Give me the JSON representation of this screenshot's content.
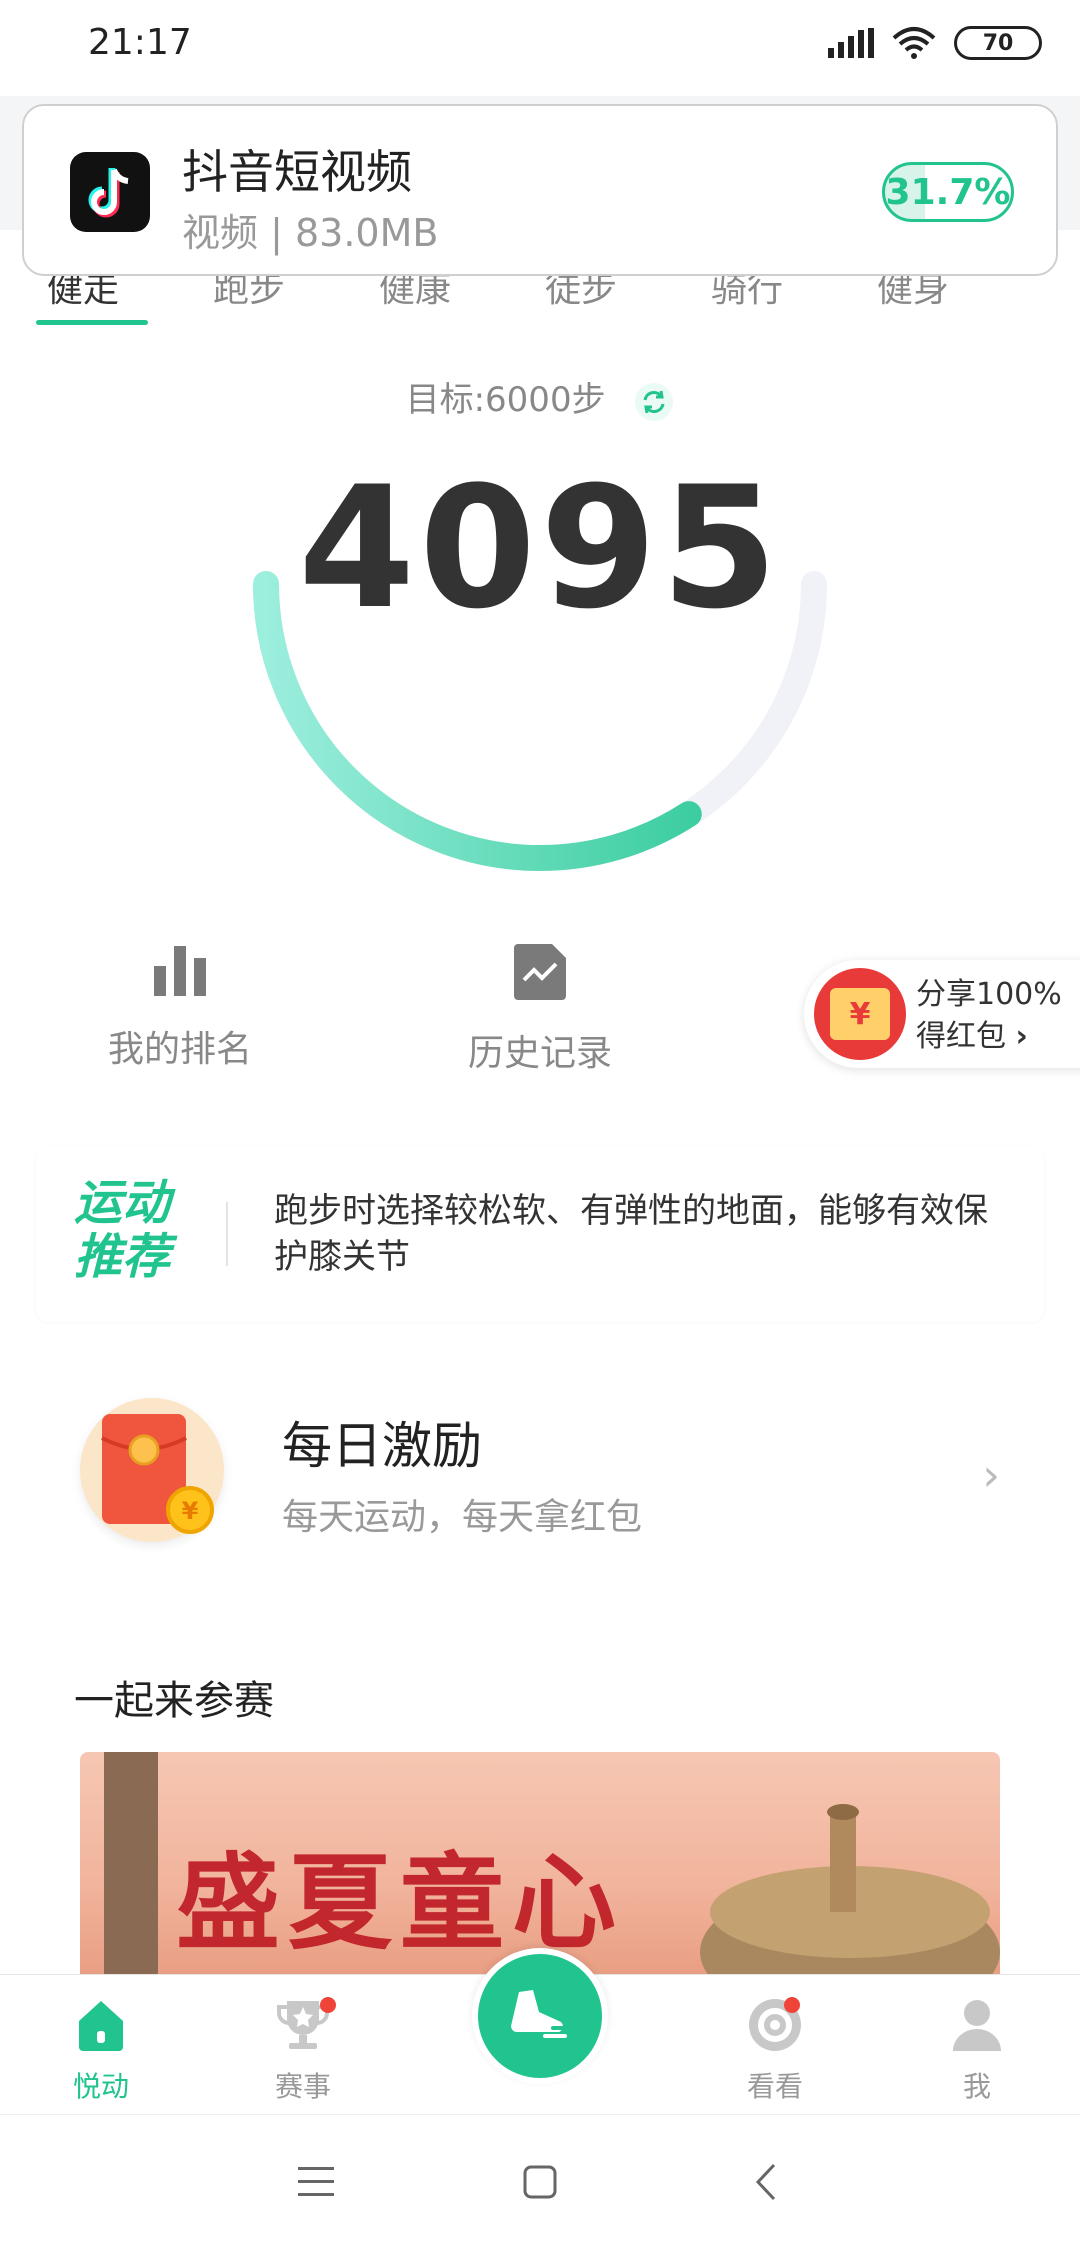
{
  "status_bar": {
    "time": "21:17",
    "battery": "70"
  },
  "notification": {
    "app_name": "抖音短视频",
    "subtitle": "视频 | 83.0MB",
    "progress": "31.7%",
    "progress_fraction": 0.317
  },
  "sport_tabs": [
    {
      "label": "健走",
      "active": true
    },
    {
      "label": "跑步",
      "active": false
    },
    {
      "label": "健康",
      "active": false
    },
    {
      "label": "徒步",
      "active": false
    },
    {
      "label": "骑行",
      "active": false
    },
    {
      "label": "健身",
      "active": false
    }
  ],
  "stats": {
    "target_label": "目标:6000步",
    "steps": "4095",
    "progress_fraction": 0.6825
  },
  "quick_actions": [
    {
      "label": "我的排名",
      "icon": "bar-chart-icon"
    },
    {
      "label": "历史记录",
      "icon": "history-chart-icon"
    }
  ],
  "share_badge": {
    "line1": "分享100%",
    "line2": "得红包",
    "coin": "¥"
  },
  "tip_card": {
    "title_line1": "运动",
    "title_line2": "推荐",
    "text": "跑步时选择较松软、有弹性的地面，能够有效保护膝关节"
  },
  "reward_card": {
    "title": "每日激励",
    "subtitle": "每天运动，每天拿红包",
    "coin": "¥"
  },
  "event_section": {
    "title": "一起来参赛",
    "banner_text": "盛夏童心"
  },
  "bottom_nav": [
    {
      "label": "悦动",
      "icon": "home-icon",
      "active": true
    },
    {
      "label": "赛事",
      "icon": "trophy-icon",
      "active": false
    },
    {
      "label": "看看",
      "icon": "discover-icon",
      "active": false
    },
    {
      "label": "我",
      "icon": "profile-icon",
      "active": false
    }
  ],
  "colors": {
    "accent": "#21c48f",
    "text": "#333333",
    "muted": "#999999"
  }
}
